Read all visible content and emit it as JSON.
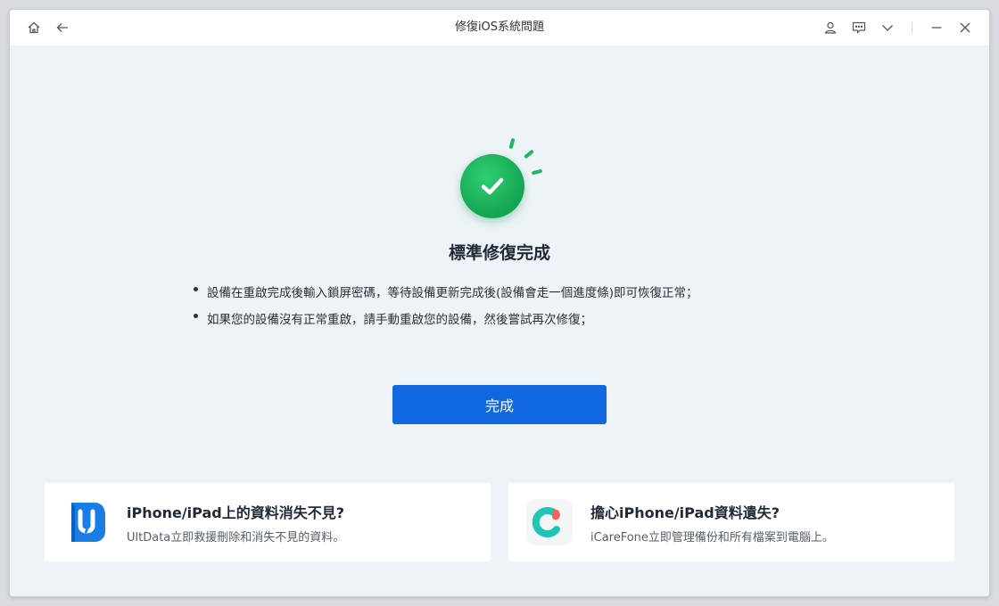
{
  "window": {
    "title": "修復iOS系統問題"
  },
  "toolbar_icons": [
    "home-icon",
    "back-arrow-icon",
    "user-icon",
    "feedback-icon",
    "chevron-down-icon",
    "minimize-icon",
    "close-icon"
  ],
  "colors": {
    "accent": "#1167e0",
    "success": "#1cb35f",
    "background": "#eef3f8"
  },
  "result": {
    "headline": "標準修復完成",
    "bullets": [
      "設備在重啟完成後輸入鎖屏密碼，等待設備更新完成後(設備會走一個進度條)即可恢復正常；",
      "如果您的設備沒有正常重啟，請手動重啟您的設備，然後嘗試再次修復；"
    ],
    "done_label": "完成"
  },
  "promos": [
    {
      "title": "iPhone/iPad上的資料消失不見?",
      "description": "UltData立即救援刪除和消失不見的資料。"
    },
    {
      "title": "擔心iPhone/iPad資料遺失?",
      "description": "iCareFone立即管理備份和所有檔案到電腦上。"
    }
  ]
}
